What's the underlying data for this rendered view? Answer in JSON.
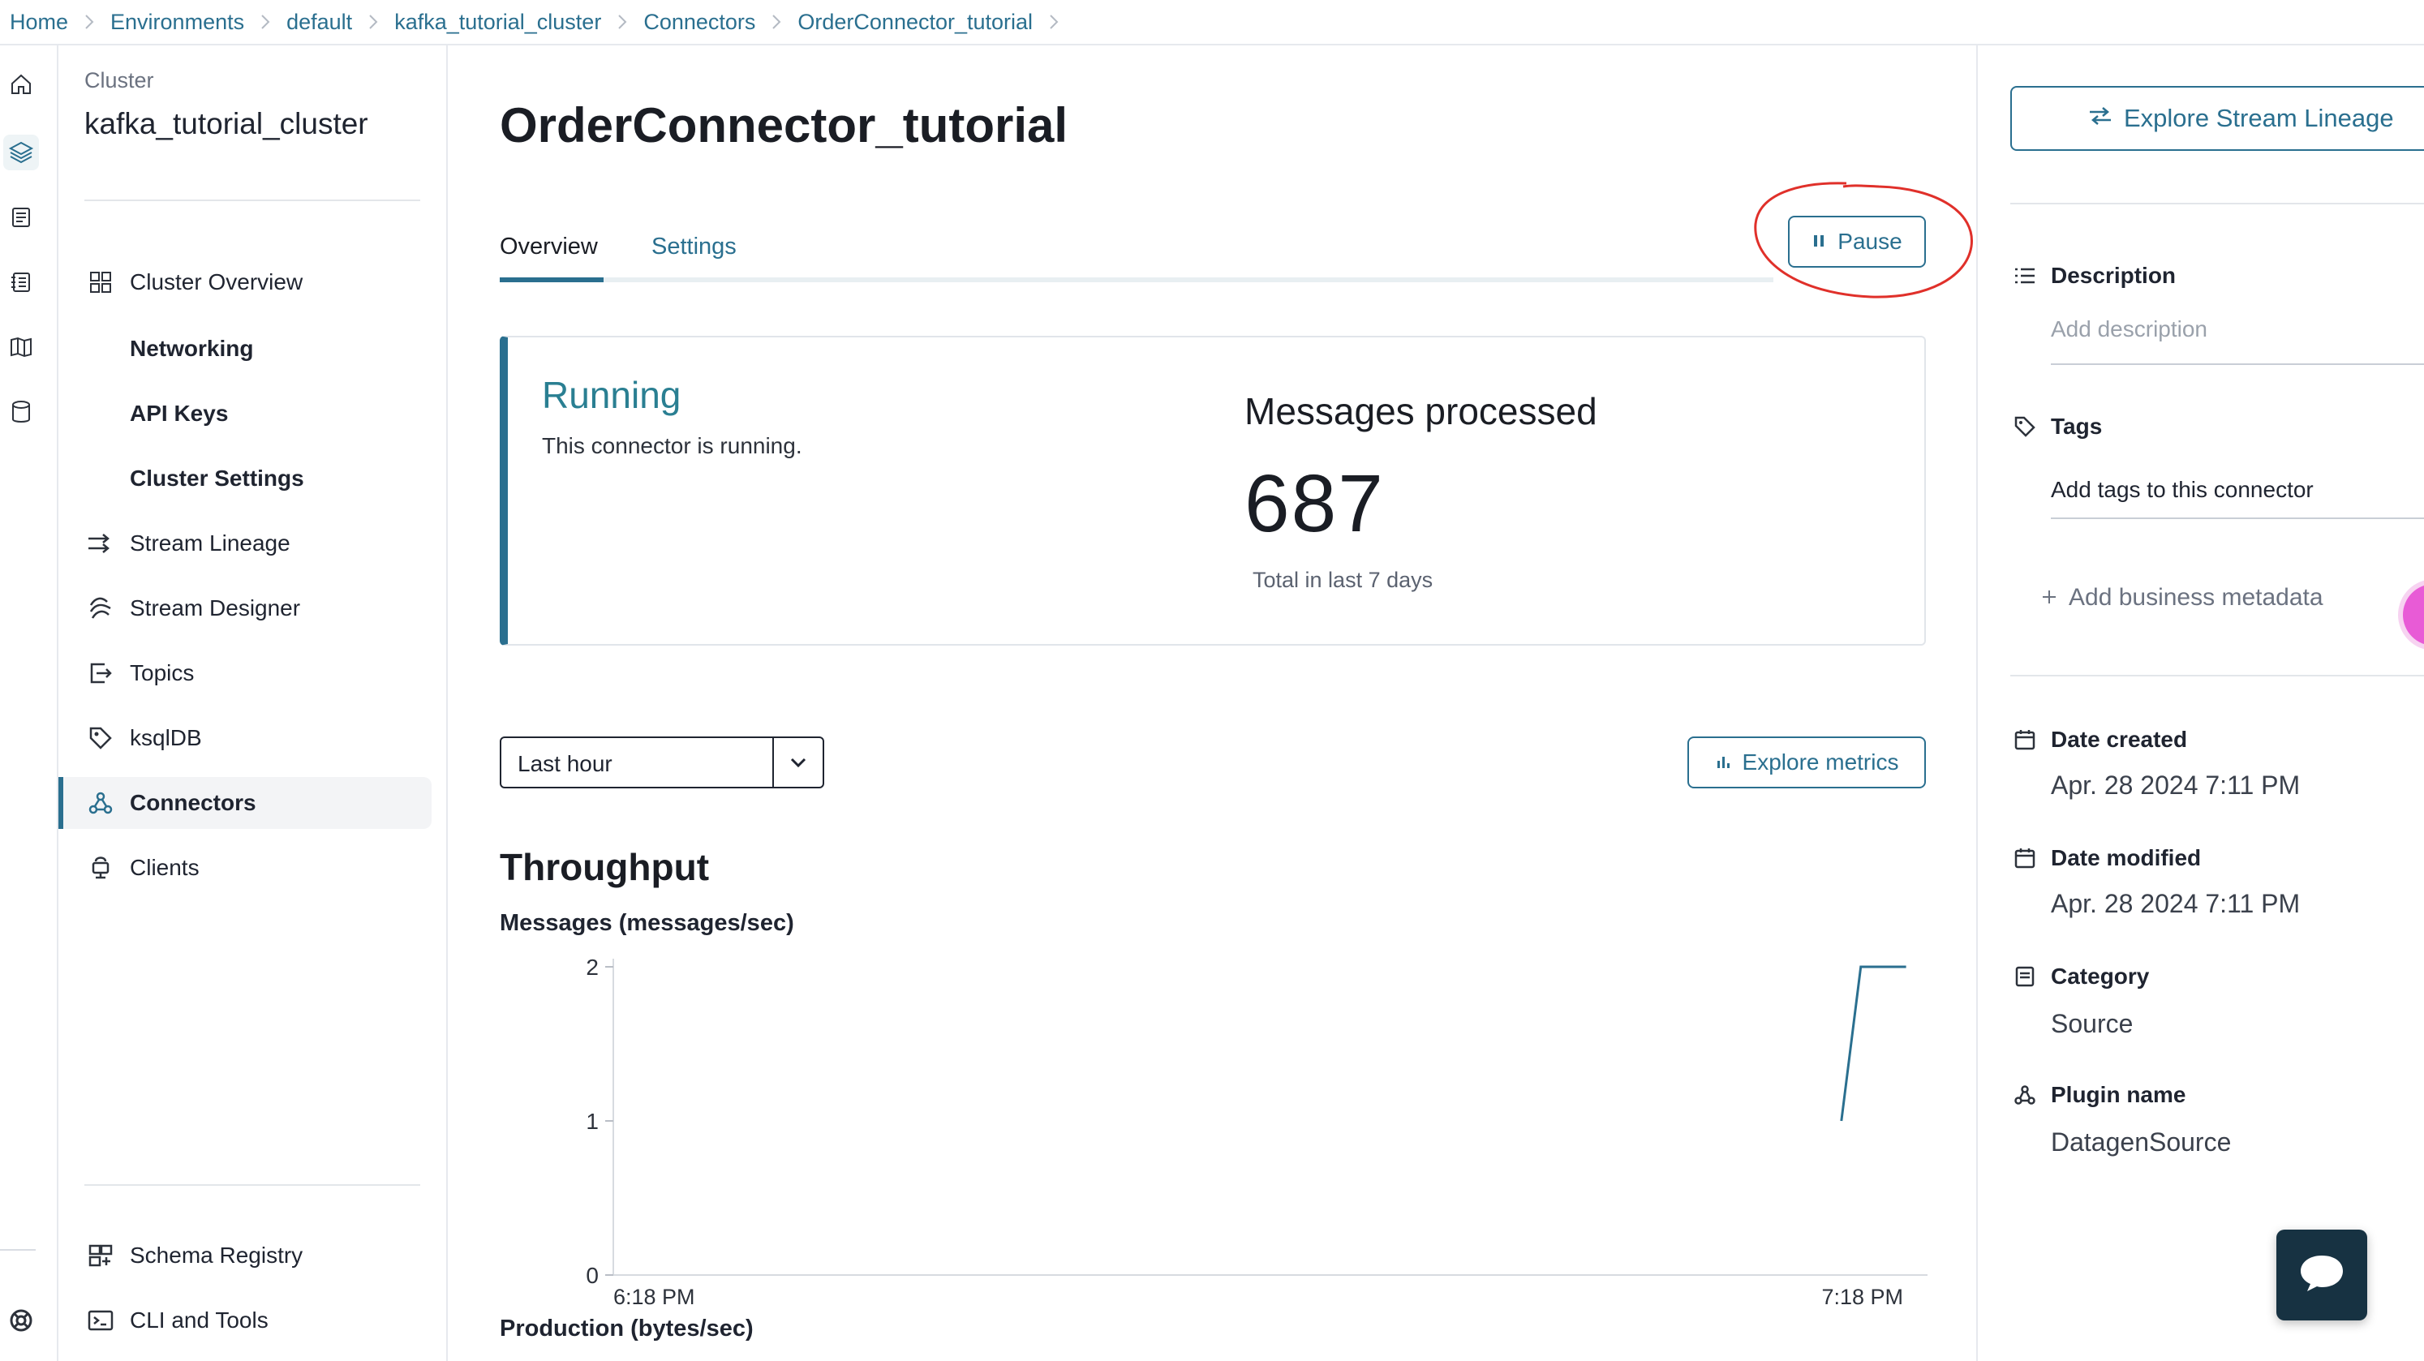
{
  "breadcrumb": [
    "Home",
    "Environments",
    "default",
    "kafka_tutorial_cluster",
    "Connectors",
    "OrderConnector_tutorial"
  ],
  "sidebar": {
    "kicker": "Cluster",
    "title": "kafka_tutorial_cluster",
    "items": [
      {
        "label": "Cluster Overview",
        "icon": "grid-icon"
      },
      {
        "label": "Networking",
        "icon": ""
      },
      {
        "label": "API Keys",
        "icon": ""
      },
      {
        "label": "Cluster Settings",
        "icon": ""
      },
      {
        "label": "Stream Lineage",
        "icon": "stream-lineage-icon"
      },
      {
        "label": "Stream Designer",
        "icon": "stream-designer-icon"
      },
      {
        "label": "Topics",
        "icon": "topics-icon"
      },
      {
        "label": "ksqlDB",
        "icon": "ksqldb-icon"
      },
      {
        "label": "Connectors",
        "icon": "connectors-icon",
        "active": true
      },
      {
        "label": "Clients",
        "icon": "clients-icon"
      }
    ],
    "bottom_items": [
      {
        "label": "Schema Registry",
        "icon": "schema-registry-icon"
      },
      {
        "label": "CLI and Tools",
        "icon": "terminal-icon"
      }
    ]
  },
  "main": {
    "title": "OrderConnector_tutorial",
    "tabs": [
      {
        "label": "Overview",
        "active": true
      },
      {
        "label": "Settings"
      }
    ],
    "pause_label": "Pause",
    "status": {
      "title": "Running",
      "subtitle": "This connector is running."
    },
    "messages": {
      "title": "Messages processed",
      "value": "687",
      "caption": "Total in last 7 days"
    },
    "time_range": "Last hour",
    "explore_metrics_label": "Explore metrics",
    "section_title": "Throughput",
    "production_title": "Production (bytes/sec)"
  },
  "chart_data": {
    "type": "line",
    "title": "Messages (messages/sec)",
    "x_tick_labels": [
      "6:18 PM",
      "7:18 PM"
    ],
    "y_ticks": [
      0,
      1,
      2
    ],
    "ylim": [
      0,
      2
    ],
    "series": [
      {
        "x": [
          0.95,
          0.965,
          1.0
        ],
        "values": [
          1,
          2,
          2
        ]
      }
    ],
    "x_range": [
      0,
      1
    ],
    "color": "#2a6f8f"
  },
  "right_panel": {
    "explore_label": "Explore Stream Lineage",
    "description_label": "Description",
    "description_placeholder": "Add description",
    "tags_label": "Tags",
    "tags_text": "Add tags to this connector",
    "business_metadata": "Add business metadata",
    "date_created_label": "Date created",
    "date_created": "Apr. 28 2024 7:11 PM",
    "date_modified_label": "Date modified",
    "date_modified": "Apr. 28 2024 7:11 PM",
    "category_label": "Category",
    "category": "Source",
    "plugin_label": "Plugin name",
    "plugin": "DatagenSource"
  },
  "colors": {
    "accent": "#2a6f8f",
    "annotation": "#e0302a",
    "chat": "#173242"
  }
}
